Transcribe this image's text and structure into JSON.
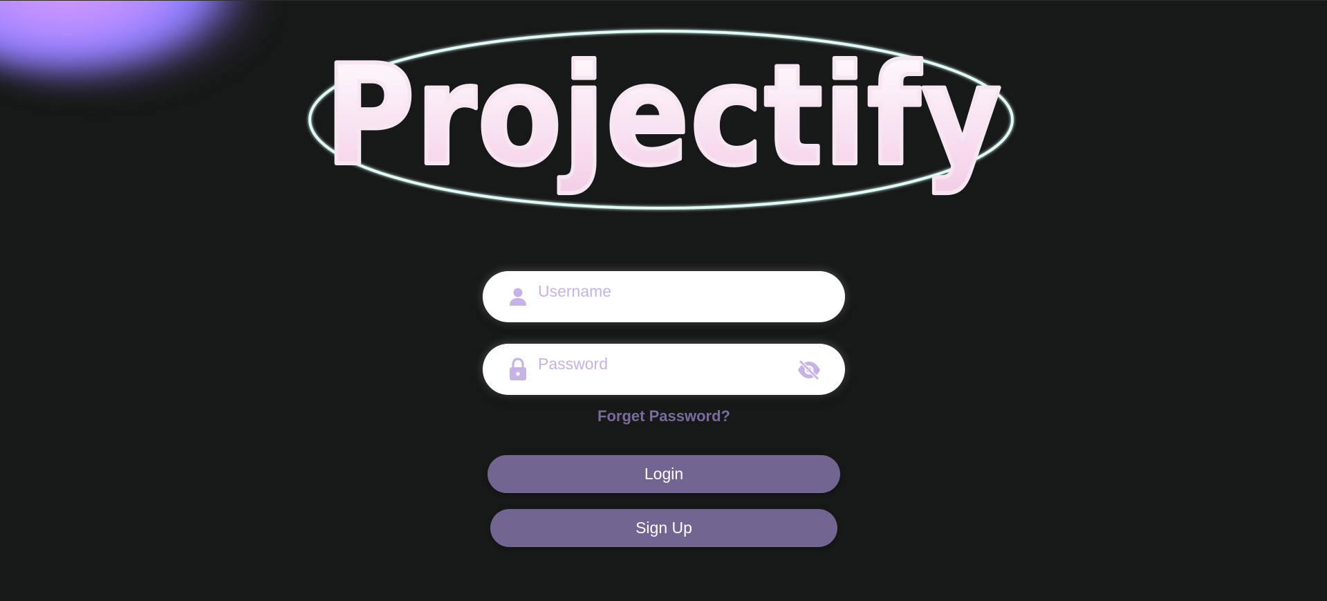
{
  "app": {
    "name": "Projectify"
  },
  "colors": {
    "background": "#171918",
    "accent": "#736592",
    "placeholder": "#c5b3e6",
    "link": "#7a6aa0",
    "logo_ring": "#dffbf6",
    "logo_fill_top": "#ffffff",
    "logo_fill_bottom": "#f3cde6"
  },
  "login_form": {
    "username": {
      "icon": "user-icon",
      "value": "",
      "placeholder": "Username"
    },
    "password": {
      "icon": "lock-icon",
      "value": "",
      "placeholder": "Password",
      "visibility_icon": "eye-off-icon"
    },
    "forgot_password_label": "Forget Password?",
    "login_label": "Login",
    "signup_label": "Sign Up"
  }
}
